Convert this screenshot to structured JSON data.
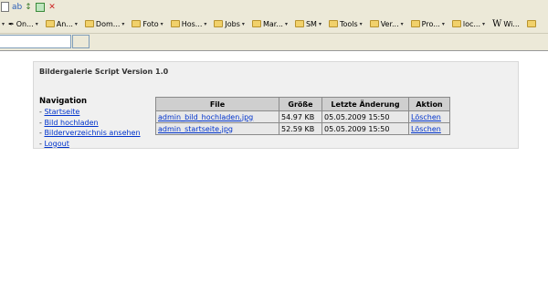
{
  "bookmarks": [
    {
      "label": "On...",
      "icon": "star-icon"
    },
    {
      "label": "An...",
      "icon": "folder-icon"
    },
    {
      "label": "Dom...",
      "icon": "folder-icon"
    },
    {
      "label": "Foto",
      "icon": "folder-icon"
    },
    {
      "label": "Hos...",
      "icon": "folder-icon"
    },
    {
      "label": "Jobs",
      "icon": "folder-icon"
    },
    {
      "label": "Mar...",
      "icon": "folder-icon"
    },
    {
      "label": "SM",
      "icon": "folder-icon"
    },
    {
      "label": "Tools",
      "icon": "folder-icon"
    },
    {
      "label": "Ver...",
      "icon": "folder-icon"
    },
    {
      "label": "Pro...",
      "icon": "folder-icon"
    },
    {
      "label": "loc...",
      "icon": "folder-icon"
    },
    {
      "label": "Wi...",
      "icon": "wikipedia-icon"
    }
  ],
  "page": {
    "title": "Bildergalerie Script Version 1.0",
    "nav_heading": "Navigation",
    "nav": [
      {
        "label": "Startseite"
      },
      {
        "label": "Bild hochladen"
      },
      {
        "label": "Bilderverzeichnis ansehen"
      },
      {
        "label": "Logout"
      }
    ],
    "bullet": "-"
  },
  "table": {
    "headers": {
      "file": "File",
      "size": "Größe",
      "changed": "Letzte Änderung",
      "action": "Aktion"
    },
    "rows": [
      {
        "file": "admin_bild_hochladen.jpg",
        "size": "54.97 KB",
        "changed": "05.05.2009 15:50",
        "action": "Löschen"
      },
      {
        "file": "admin_startseite.jpg",
        "size": "52.59 KB",
        "changed": "05.05.2009 15:50",
        "action": "Löschen"
      }
    ]
  }
}
